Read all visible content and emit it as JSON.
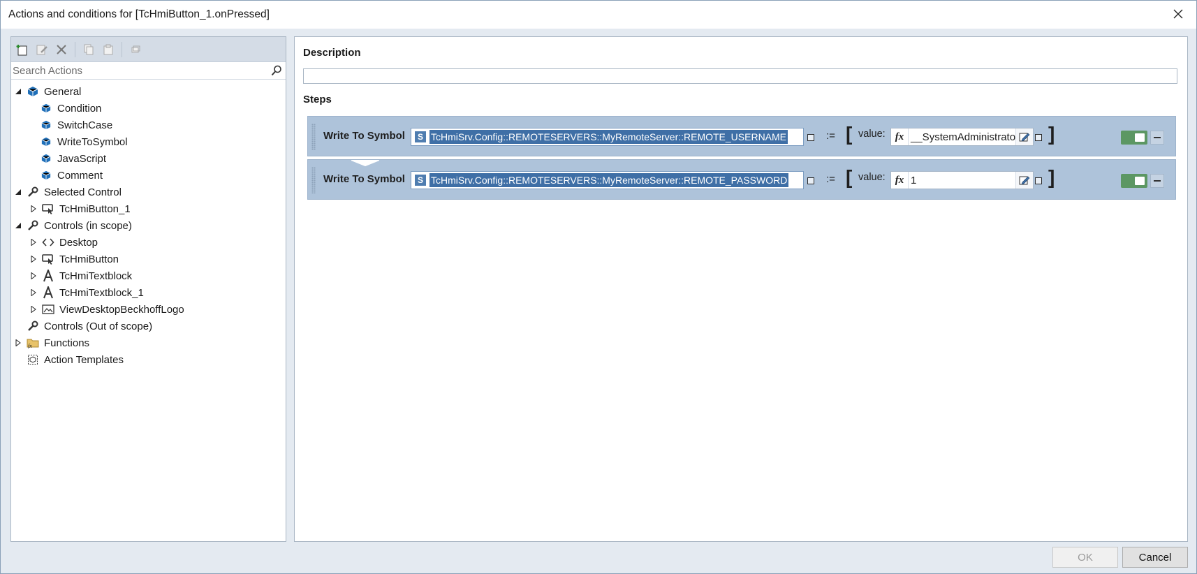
{
  "window": {
    "title": "Actions and conditions for [TcHmiButton_1.onPressed]"
  },
  "search": {
    "placeholder": "Search Actions"
  },
  "tree": {
    "general": "General",
    "condition": "Condition",
    "switchcase": "SwitchCase",
    "writetosymbol": "WriteToSymbol",
    "javascript": "JavaScript",
    "comment": "Comment",
    "selected_control": "Selected Control",
    "tchmibutton_1": "TcHmiButton_1",
    "controls_in_scope": "Controls (in scope)",
    "desktop": "Desktop",
    "tchmibutton": "TcHmiButton",
    "tchmitextblock": "TcHmiTextblock",
    "tchmitextblock_1": "TcHmiTextblock_1",
    "viewdesktop": "ViewDesktopBeckhoffLogo",
    "controls_out_scope": "Controls (Out of scope)",
    "functions": "Functions",
    "action_templates": "Action Templates"
  },
  "main": {
    "description_label": "Description",
    "description_value": "",
    "steps_label": "Steps",
    "steps": [
      {
        "name": "Write To Symbol",
        "symbol_badge": "S",
        "symbol": "TcHmiSrv.Config::REMOTESERVERS::MyRemoteServer::REMOTE_USERNAME",
        "assign": ":=",
        "value_label": "value:",
        "value": "__SystemAdministrator"
      },
      {
        "name": "Write To Symbol",
        "symbol_badge": "S",
        "symbol": "TcHmiSrv.Config::REMOTESERVERS::MyRemoteServer::REMOTE_PASSWORD",
        "assign": ":=",
        "value_label": "value:",
        "value": "1"
      }
    ]
  },
  "buttons": {
    "ok": "OK",
    "cancel": "Cancel"
  },
  "colors": {
    "accent": "#3f6fa6",
    "step_bg": "#aec3da",
    "toggle_on": "#5c9763"
  }
}
